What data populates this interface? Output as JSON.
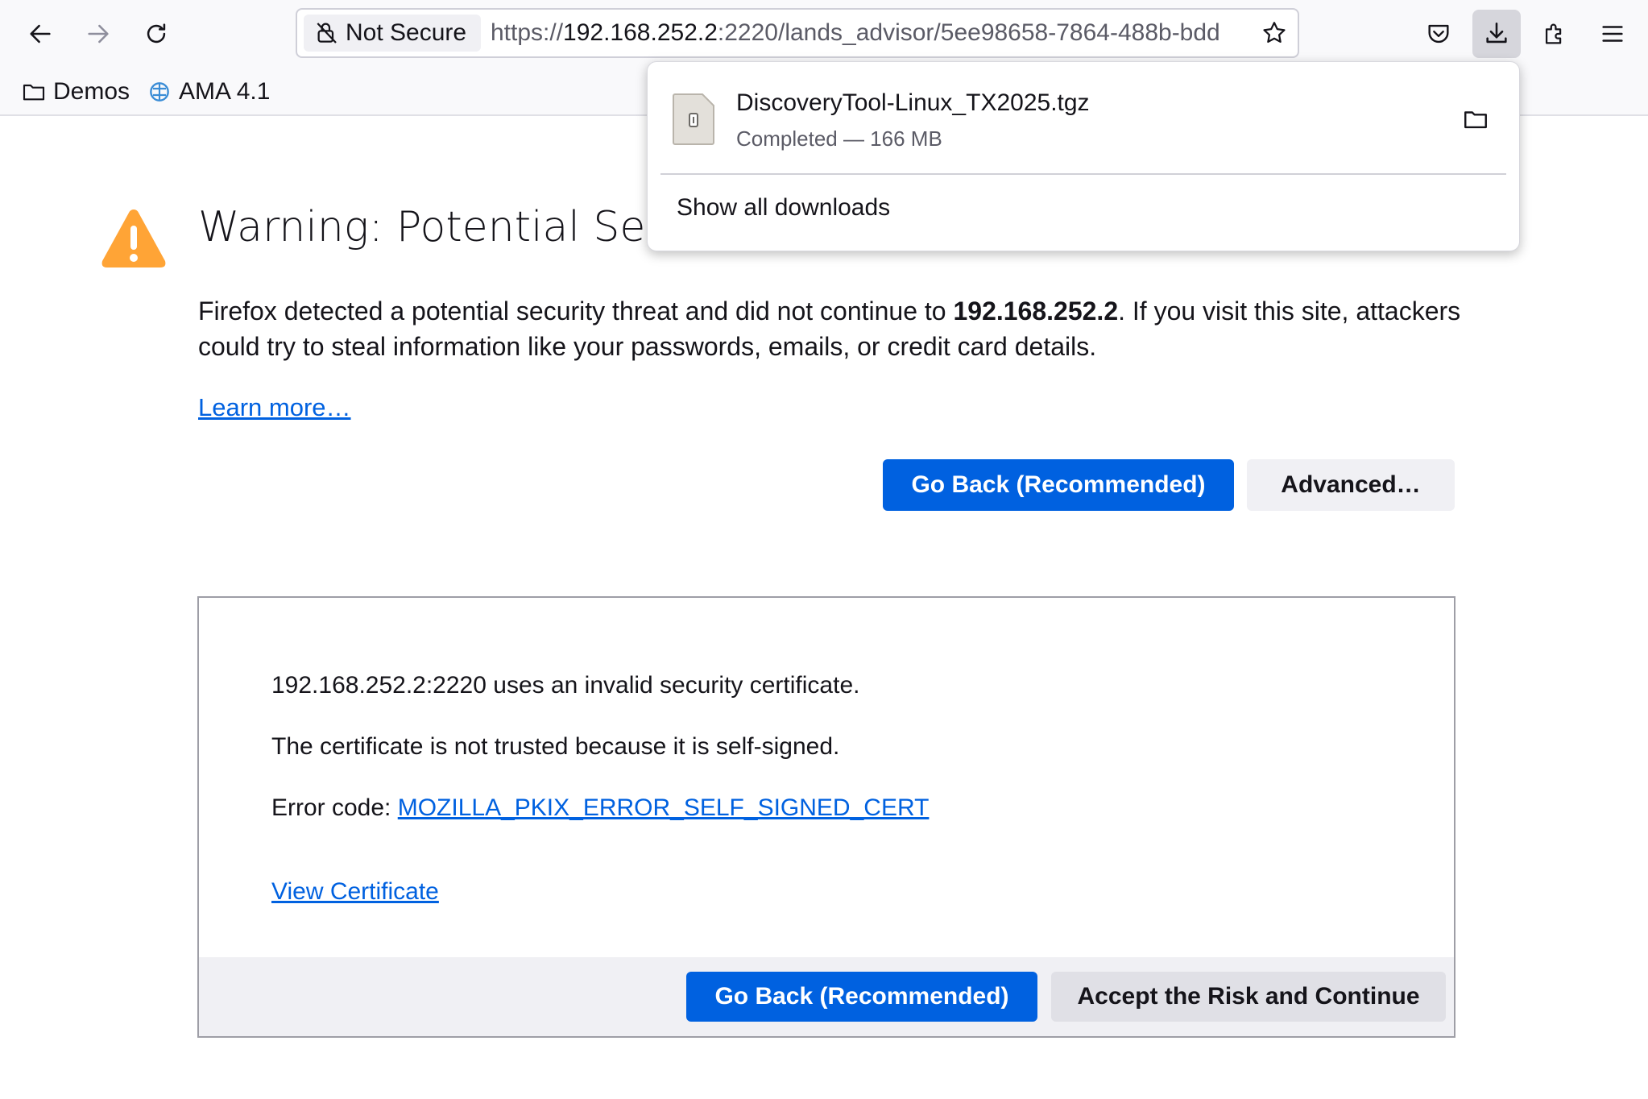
{
  "toolbar": {
    "identity_label": "Not Secure",
    "url_prefix": "https://",
    "url_host": "192.168.252.2",
    "url_rest": ":2220/lands_advisor/5ee98658-7864-488b-bdd"
  },
  "bookmarks": [
    {
      "label": "Demos",
      "icon": "folder-icon"
    },
    {
      "label": "AMA 4.1",
      "icon": "bookmark-favicon"
    }
  ],
  "error_page": {
    "title": "Warning: Potential Secu",
    "intro_before": "Firefox detected a potential security threat and did not continue to ",
    "intro_host": "192.168.252.2",
    "intro_after": ". If you visit this site, attackers could try to steal information like your passwords, emails, or credit card details.",
    "learn_more": "Learn more…",
    "go_back_label": "Go Back (Recommended)",
    "advanced_label": "Advanced…",
    "advanced_panel": {
      "line1": "192.168.252.2:2220 uses an invalid security certificate.",
      "line2": "The certificate is not trusted because it is self-signed.",
      "error_code_label": "Error code: ",
      "error_code": "MOZILLA_PKIX_ERROR_SELF_SIGNED_CERT",
      "view_certificate": "View Certificate",
      "go_back_label": "Go Back (Recommended)",
      "accept_label": "Accept the Risk and Continue"
    }
  },
  "downloads_panel": {
    "file_name": "DiscoveryTool-Linux_TX2025.tgz",
    "status": "Completed — 166 MB",
    "show_all": "Show all downloads"
  },
  "colors": {
    "accent": "#0061e0",
    "warning": "#ffa436",
    "chrome_bg": "#f9f9fb"
  }
}
